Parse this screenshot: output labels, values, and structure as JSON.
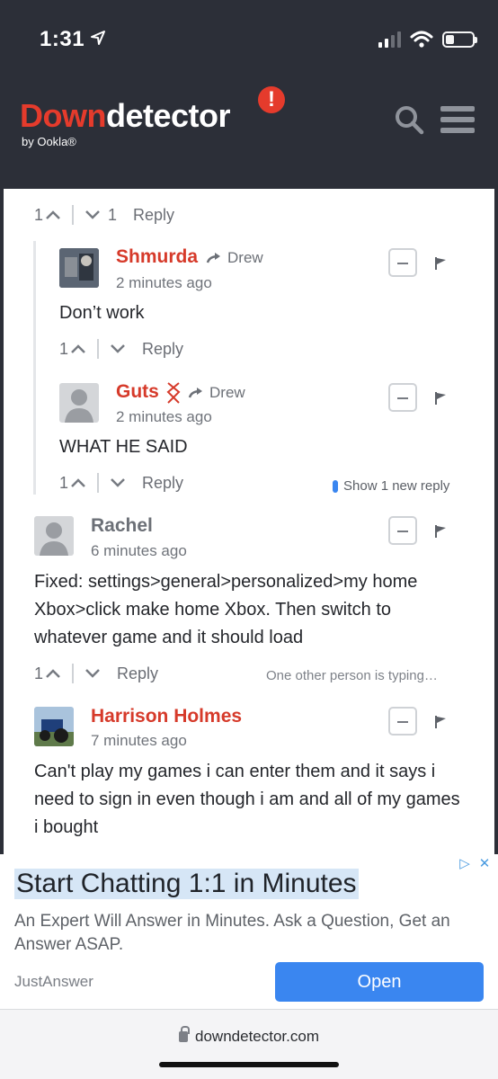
{
  "status": {
    "time": "1:31"
  },
  "header": {
    "logo_down": "Down",
    "logo_detector": "detector",
    "logo_badge": "!",
    "byline": "by Ookla®"
  },
  "comments": [
    {
      "vote_up": "1",
      "vote_down": "1",
      "reply": "Reply"
    },
    {
      "author": "Shmurda",
      "to": "Drew",
      "time": "2 minutes ago",
      "text": "Don’t work",
      "vote_up": "1",
      "reply": "Reply"
    },
    {
      "author": "Guts",
      "to": "Drew",
      "time": "2 minutes ago",
      "text": "WHAT HE SAID",
      "vote_up": "1",
      "reply": "Reply",
      "new_reply": "Show 1 new reply"
    },
    {
      "author": "Rachel",
      "time": "6 minutes ago",
      "text": "Fixed: settings>general>personalized>my home Xbox>click make home Xbox. Then switch to whatever game and it should load",
      "vote_up": "1",
      "reply": "Reply",
      "typing": "One other person is typing…"
    },
    {
      "author": "Harrison Holmes",
      "time": "7 minutes ago",
      "text": "Can't play my games i can enter them and it says i need to sign in even though i am and all of my games i bought"
    }
  ],
  "ad": {
    "title": "Start Chatting 1:1 in Minutes",
    "description": "An Expert Will Answer in Minutes. Ask a Question, Get an Answer ASAP.",
    "brand": "JustAnswer",
    "cta": "Open"
  },
  "browser": {
    "url": "downdetector.com"
  },
  "colors": {
    "brand_red": "#e53b2c",
    "header_bg": "#2c2f38",
    "cta_blue": "#3a86f0"
  }
}
